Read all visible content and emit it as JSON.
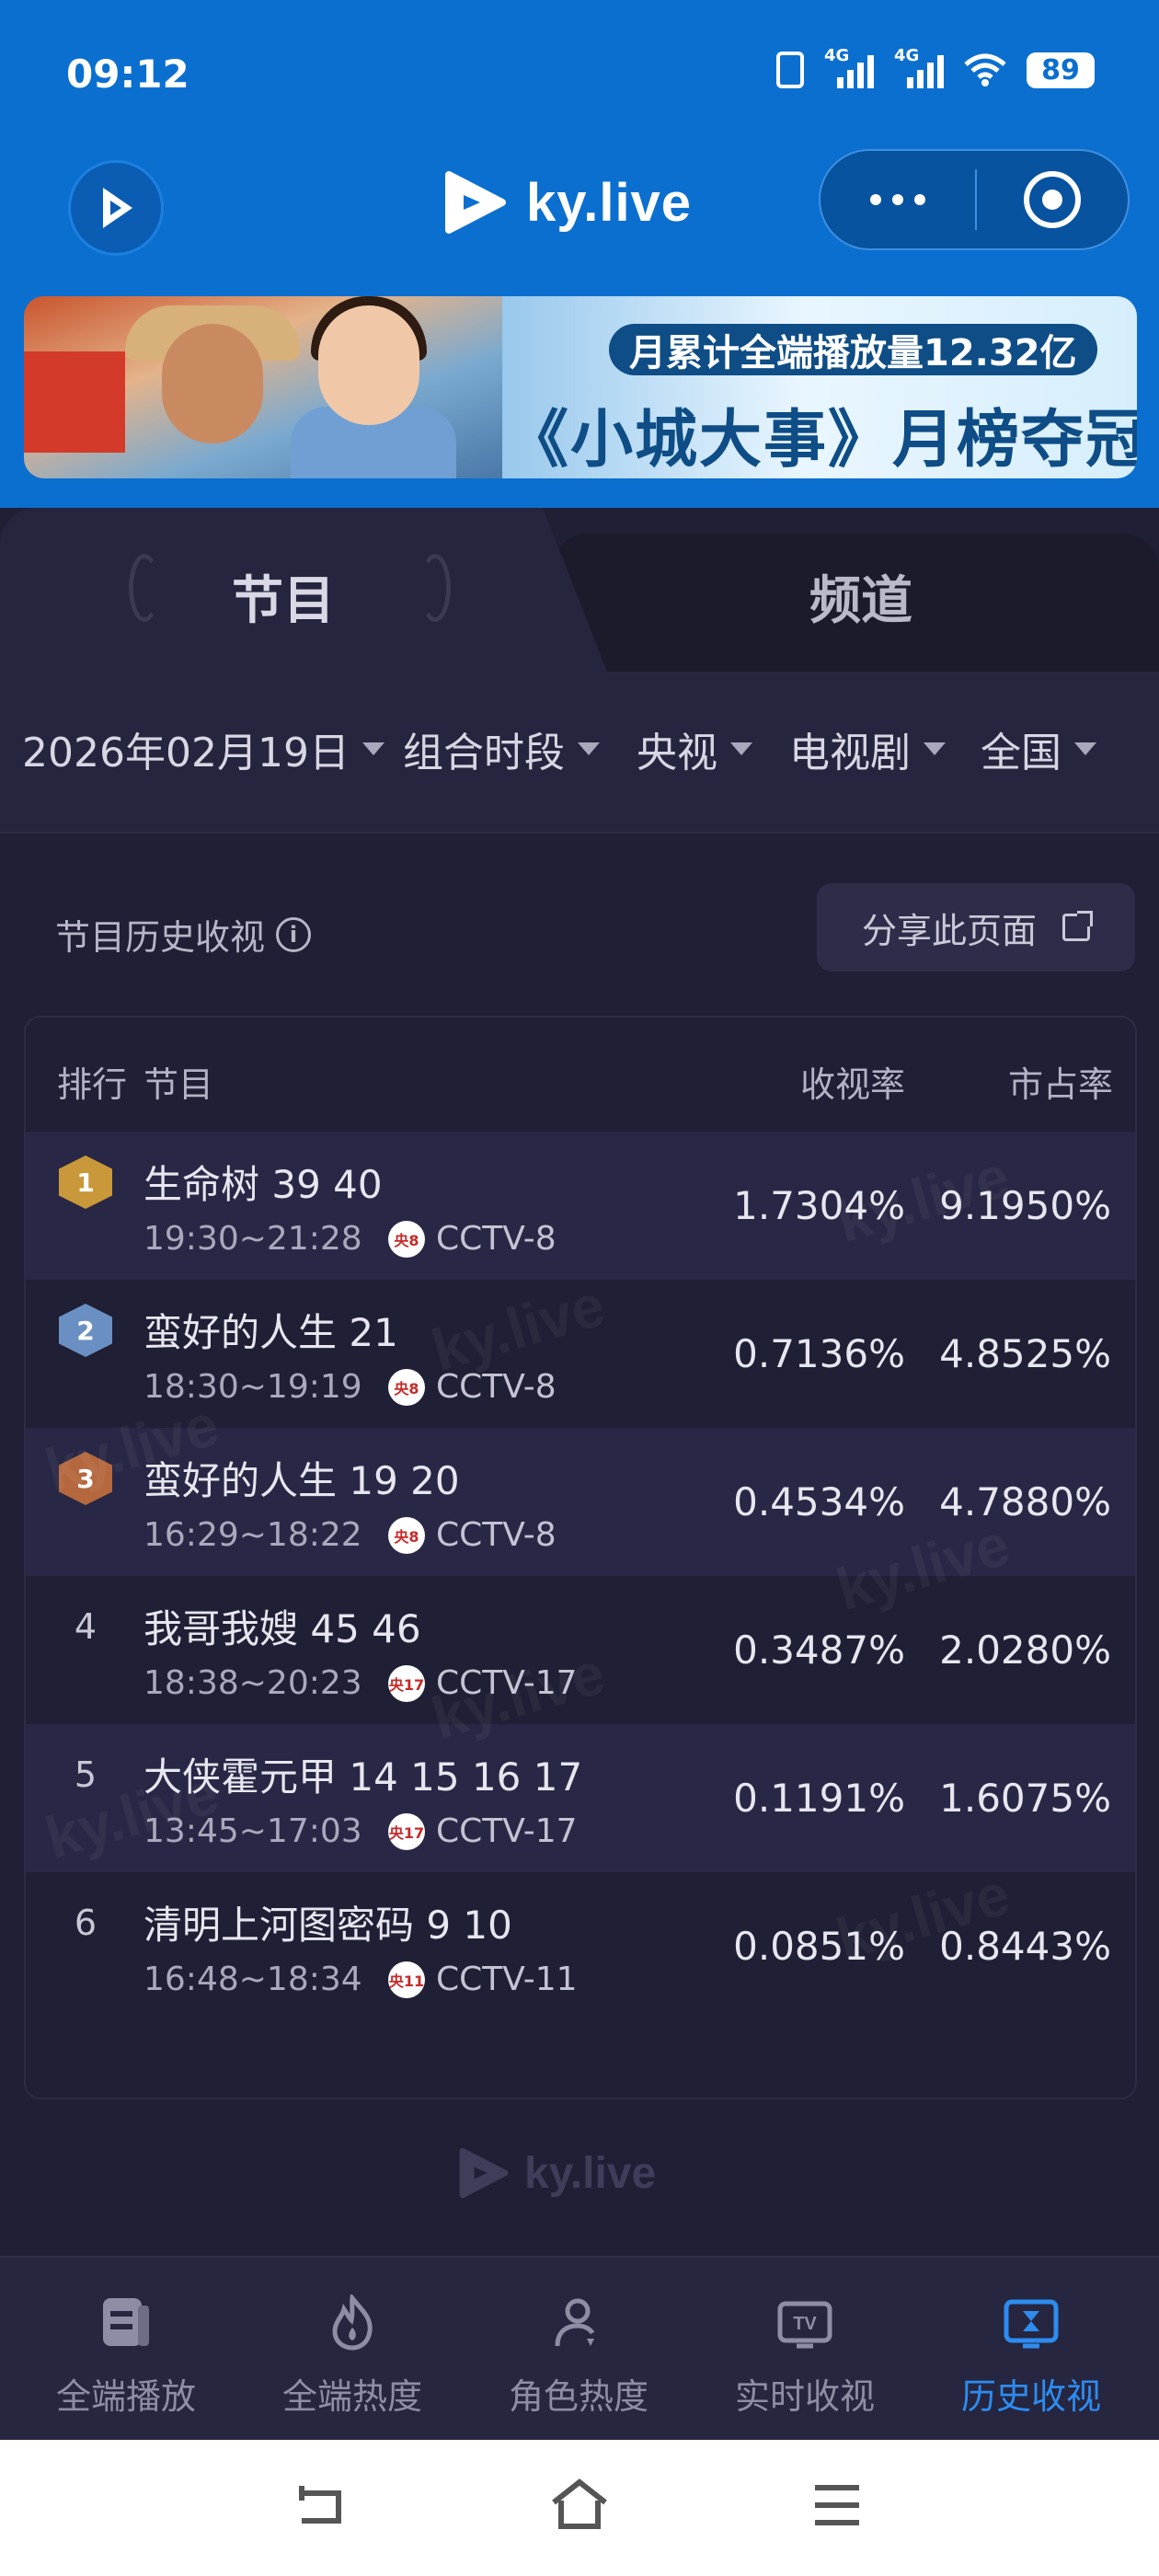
{
  "status_bar": {
    "time": "09:12",
    "signal1": "4G",
    "signal2": "4G",
    "battery": "89"
  },
  "header": {
    "brand": "ky.live"
  },
  "banner": {
    "tag": "月累计全端播放量12.32亿",
    "title": "《小城大事》月榜夺冠"
  },
  "tabs": [
    {
      "label": "节目",
      "active": true
    },
    {
      "label": "频道",
      "active": false
    }
  ],
  "filters": {
    "date": "2026年02月19日",
    "period": "组合时段",
    "channel_group": "央视",
    "genre": "电视剧",
    "region": "全国"
  },
  "section": {
    "title": "节目历史收视",
    "share_label": "分享此页面"
  },
  "table": {
    "headers": {
      "rank": "排行",
      "program": "节目",
      "rating": "收视率",
      "share": "市占率"
    },
    "rows": [
      {
        "rank": "1",
        "medal": "gold",
        "name": "生命树 39 40",
        "time": "19:30~21:28",
        "logo": "央8",
        "channel": "CCTV-8",
        "rating": "1.7304%",
        "share": "9.1950%"
      },
      {
        "rank": "2",
        "medal": "silver",
        "name": "蛮好的人生 21",
        "time": "18:30~19:19",
        "logo": "央8",
        "channel": "CCTV-8",
        "rating": "0.7136%",
        "share": "4.8525%"
      },
      {
        "rank": "3",
        "medal": "bronze",
        "name": "蛮好的人生 19 20",
        "time": "16:29~18:22",
        "logo": "央8",
        "channel": "CCTV-8",
        "rating": "0.4534%",
        "share": "4.7880%"
      },
      {
        "rank": "4",
        "medal": "",
        "name": "我哥我嫂 45 46",
        "time": "18:38~20:23",
        "logo": "央17",
        "channel": "CCTV-17",
        "rating": "0.3487%",
        "share": "2.0280%"
      },
      {
        "rank": "5",
        "medal": "",
        "name": "大侠霍元甲 14 15 16 17",
        "time": "13:45~17:03",
        "logo": "央17",
        "channel": "CCTV-17",
        "rating": "0.1191%",
        "share": "1.6075%"
      },
      {
        "rank": "6",
        "medal": "",
        "name": "清明上河图密码 9 10",
        "time": "16:48~18:34",
        "logo": "央11",
        "channel": "CCTV-11",
        "rating": "0.0851%",
        "share": "0.8443%"
      }
    ]
  },
  "footer": {
    "brand": "ky.live"
  },
  "bottom_nav": [
    {
      "label": "全端播放",
      "icon": "document-icon",
      "active": false
    },
    {
      "label": "全端热度",
      "icon": "flame-icon",
      "active": false
    },
    {
      "label": "角色热度",
      "icon": "person-icon",
      "active": false
    },
    {
      "label": "实时收视",
      "icon": "tv-icon",
      "active": false
    },
    {
      "label": "历史收视",
      "icon": "history-icon",
      "active": true
    }
  ],
  "colors": {
    "header_blue": "#0b6fd0",
    "panel_dark": "#1f1f35",
    "active_nav": "#2d8cf0",
    "medal_gold": "#c9983a",
    "medal_silver": "#6a8fc2",
    "medal_bronze": "#b5683e"
  }
}
